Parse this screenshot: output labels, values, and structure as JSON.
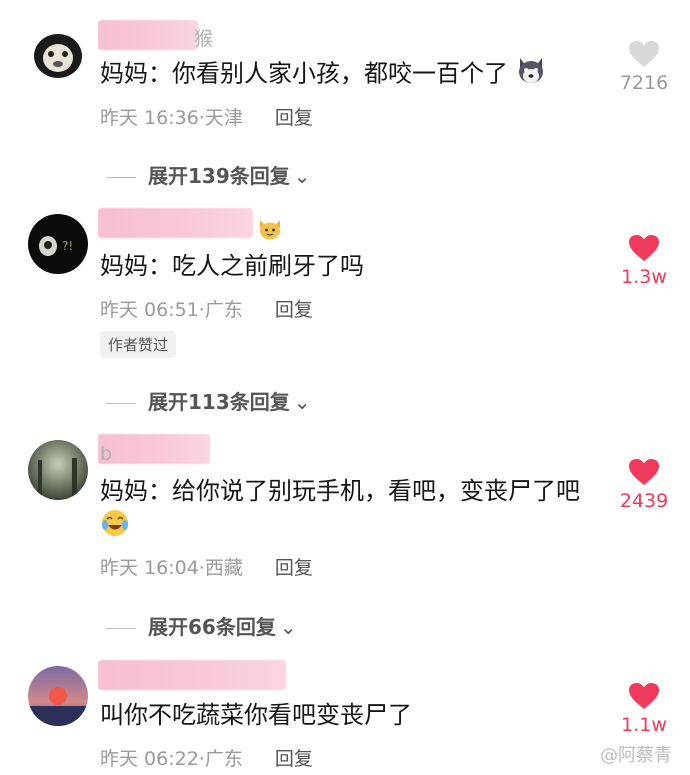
{
  "comments": [
    {
      "username_visible": "猴",
      "text": "妈妈：你看别人家小孩，都咬一百个了",
      "time": "昨天 16:36",
      "location": "天津",
      "reply_label": "回复",
      "likes": "7216",
      "liked": false,
      "expand_label": "展开139条回复"
    },
    {
      "username_visible": "",
      "text": "妈妈：吃人之前刷牙了吗",
      "time": "昨天 06:51",
      "location": "广东",
      "reply_label": "回复",
      "likes": "1.3w",
      "liked": true,
      "tag": "作者赞过",
      "expand_label": "展开113条回复"
    },
    {
      "username_visible": "b",
      "text_line1": "妈妈：给你说了别玩手机，看吧，变丧尸了吧",
      "time": "昨天 16:04",
      "location": "西藏",
      "reply_label": "回复",
      "likes": "2439",
      "liked": true,
      "expand_label": "展开66条回复"
    },
    {
      "username_visible": "",
      "text": "叫你不吃蔬菜你看吧变丧尸了",
      "time": "昨天 06:22",
      "location": "广东",
      "reply_label": "回复",
      "likes": "1.1w",
      "liked": true
    }
  ],
  "watermark": "@阿蔡青",
  "colors": {
    "liked": "#ef3a5d",
    "unliked": "#d8d8d8",
    "meta": "#9a9a9a"
  }
}
